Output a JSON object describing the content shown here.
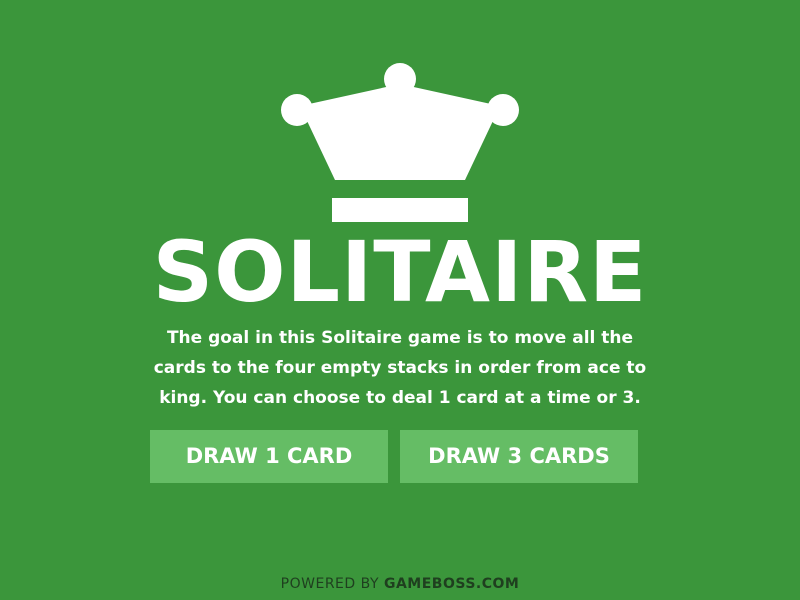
{
  "colors": {
    "background": "#3b963b",
    "button": "#65bd65",
    "text": "#ffffff",
    "footer_text": "#1f3f1f"
  },
  "logo": {
    "icon": "crown-icon"
  },
  "title": "SOLITAIRE",
  "description": "The goal in this Solitaire game is to move all the cards to the four empty stacks in order from ace to king. You can choose to deal 1 card at a time or 3.",
  "buttons": {
    "draw_one": "DRAW 1 CARD",
    "draw_three": "DRAW 3 CARDS"
  },
  "footer": {
    "prefix": "POWERED BY ",
    "brand": "GAMEBOSS.COM"
  }
}
